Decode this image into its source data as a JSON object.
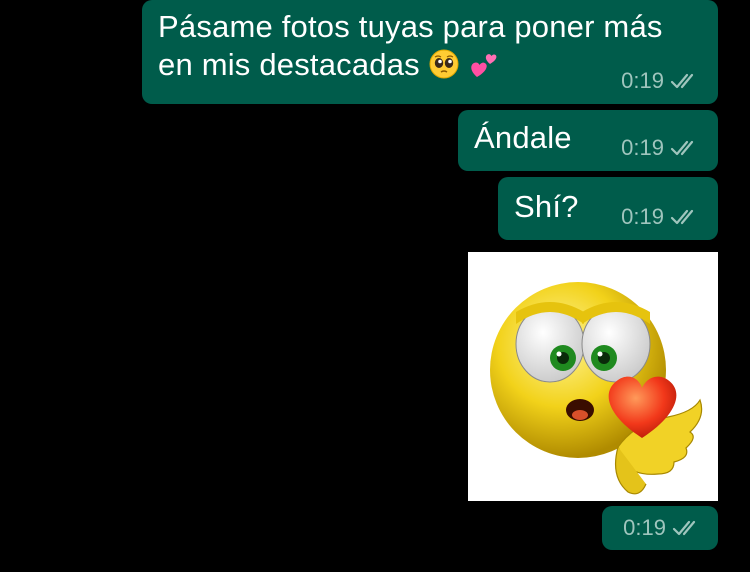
{
  "messages": [
    {
      "text_before_emoji": "Pásame fotos tuyas para poner más en mis destacadas",
      "emojis": [
        "pleading-face",
        "two-hearts"
      ],
      "time": "0:19",
      "status": "delivered"
    },
    {
      "text": "Ándale",
      "time": "0:19",
      "status": "delivered"
    },
    {
      "text": "Shí?",
      "time": "0:19",
      "status": "delivered"
    },
    {
      "type": "sticker",
      "sticker": "yellow-smiley-blowing-heart-sticker",
      "time": "0:19",
      "status": "delivered"
    }
  ],
  "colors": {
    "background": "#000000",
    "outgoing_bubble": "#005c4b",
    "timestamp": "#9fc5bd"
  }
}
